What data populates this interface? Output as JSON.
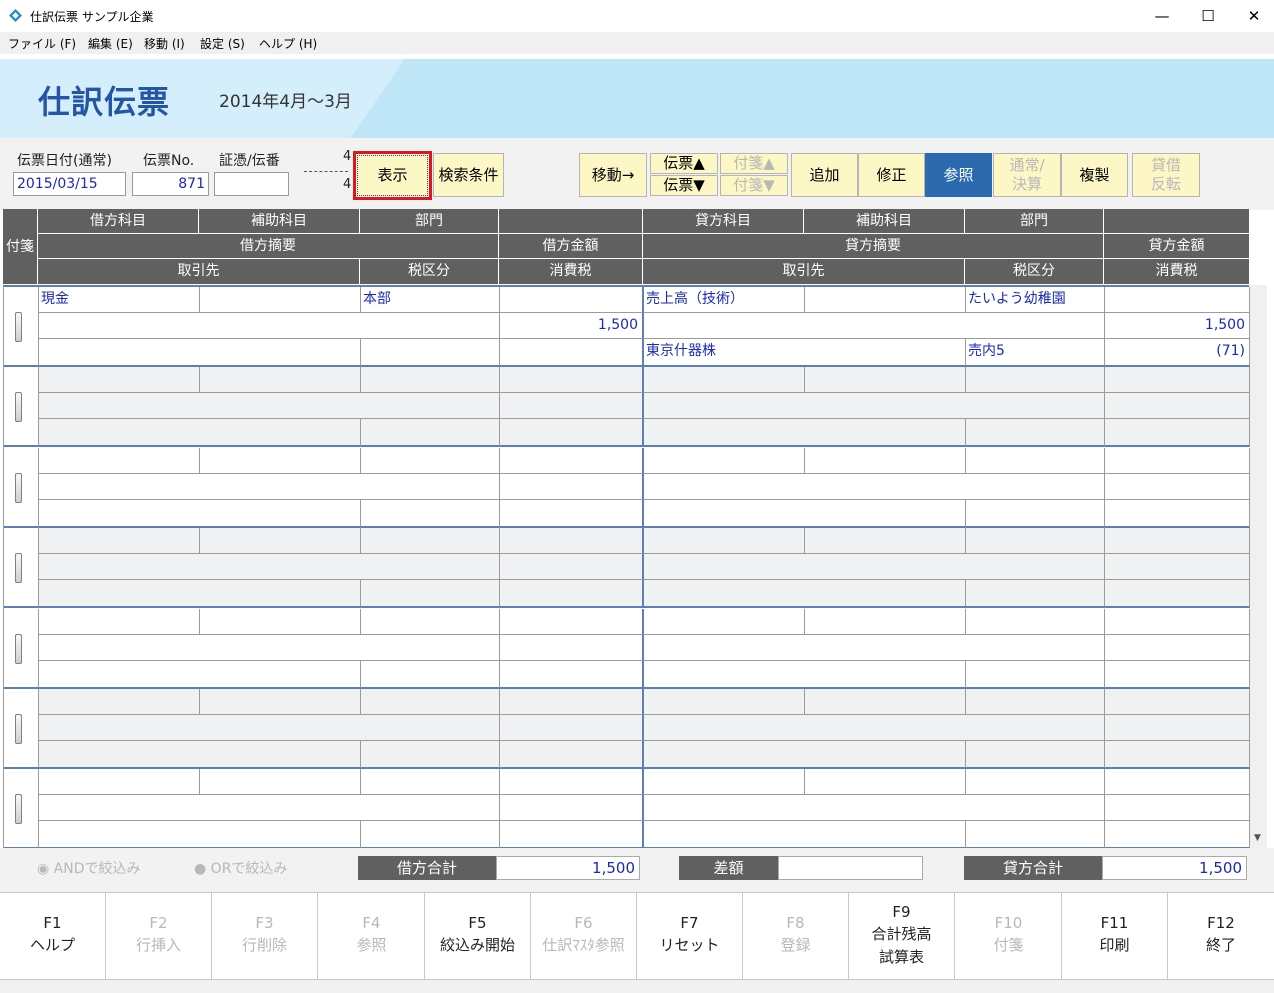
{
  "window": {
    "title": "仕訳伝票 サンプル企業",
    "min": "—",
    "max": "☐",
    "close": "✕"
  },
  "menu": [
    "ファイル (F)",
    "編集 (E)",
    "移動 (I)",
    "設定 (S)",
    "ヘルプ (H)"
  ],
  "header": {
    "title": "仕訳伝票",
    "period": "2014年4月～3月"
  },
  "form": {
    "date_label": "伝票日付(通常)",
    "date_value": "2015/03/15",
    "no_label": "伝票No.",
    "no_value": "871",
    "cert_label": "証憑/伝番",
    "cert_value": "",
    "count_top": "4",
    "count_bottom": "4",
    "display_button": "表示",
    "search_button": "検索条件",
    "move_button": "移動→",
    "slip_up": "伝票▲",
    "slip_down": "伝票▼",
    "tag_up": "付箋▲",
    "tag_down": "付箋▼",
    "add": "追加",
    "edit": "修正",
    "ref": "参照",
    "normal_1": "通常/",
    "normal_2": "決算",
    "copy": "複製",
    "swap_1": "貸借",
    "swap_2": "反転"
  },
  "grid_header": {
    "tag": "付箋",
    "debit_account": "借方科目",
    "debit_sub": "補助科目",
    "debit_dept": "部門",
    "debit_memo": "借方摘要",
    "debit_amount": "借方金額",
    "debit_partner": "取引先",
    "debit_tax": "税区分",
    "debit_cons": "消費税",
    "credit_account": "貸方科目",
    "credit_sub": "補助科目",
    "credit_dept": "部門",
    "credit_memo": "貸方摘要",
    "credit_amount": "貸方金額",
    "credit_partner": "取引先",
    "credit_tax": "税区分",
    "credit_cons": "消費税"
  },
  "entries": [
    {
      "debit_account": "現金",
      "debit_sub": "",
      "debit_dept": "本部",
      "debit_memo": "",
      "debit_amount": "1,500",
      "debit_partner": "",
      "debit_tax": "",
      "debit_cons": "",
      "credit_account": "売上高（技術）",
      "credit_sub": "",
      "credit_dept": "たいよう幼稚園",
      "credit_memo": "",
      "credit_amount": "1,500",
      "credit_partner": "東京什器株",
      "credit_tax": "売内5",
      "credit_cons": "(71)"
    }
  ],
  "totals": {
    "and_filter": "ANDで絞込み",
    "or_filter": "ORで絞込み",
    "debit_total_label": "借方合計",
    "debit_total": "1,500",
    "diff_label": "差額",
    "diff": "",
    "credit_total_label": "貸方合計",
    "credit_total": "1,500"
  },
  "fkeys": [
    {
      "key": "F1",
      "label": "ヘルプ",
      "enabled": true
    },
    {
      "key": "F2",
      "label": "行挿入",
      "enabled": false
    },
    {
      "key": "F3",
      "label": "行削除",
      "enabled": false
    },
    {
      "key": "F4",
      "label": "参照",
      "enabled": false
    },
    {
      "key": "F5",
      "label": "絞込み開始",
      "enabled": true
    },
    {
      "key": "F6",
      "label": "仕訳ﾏｽﾀ参照",
      "enabled": false
    },
    {
      "key": "F7",
      "label": "リセット",
      "enabled": true
    },
    {
      "key": "F8",
      "label": "登録",
      "enabled": false
    },
    {
      "key": "F9",
      "label": "合計残高",
      "label2": "試算表",
      "enabled": true
    },
    {
      "key": "F10",
      "label": "付箋",
      "enabled": false
    },
    {
      "key": "F11",
      "label": "印刷",
      "enabled": true
    },
    {
      "key": "F12",
      "label": "終了",
      "enabled": true
    }
  ]
}
